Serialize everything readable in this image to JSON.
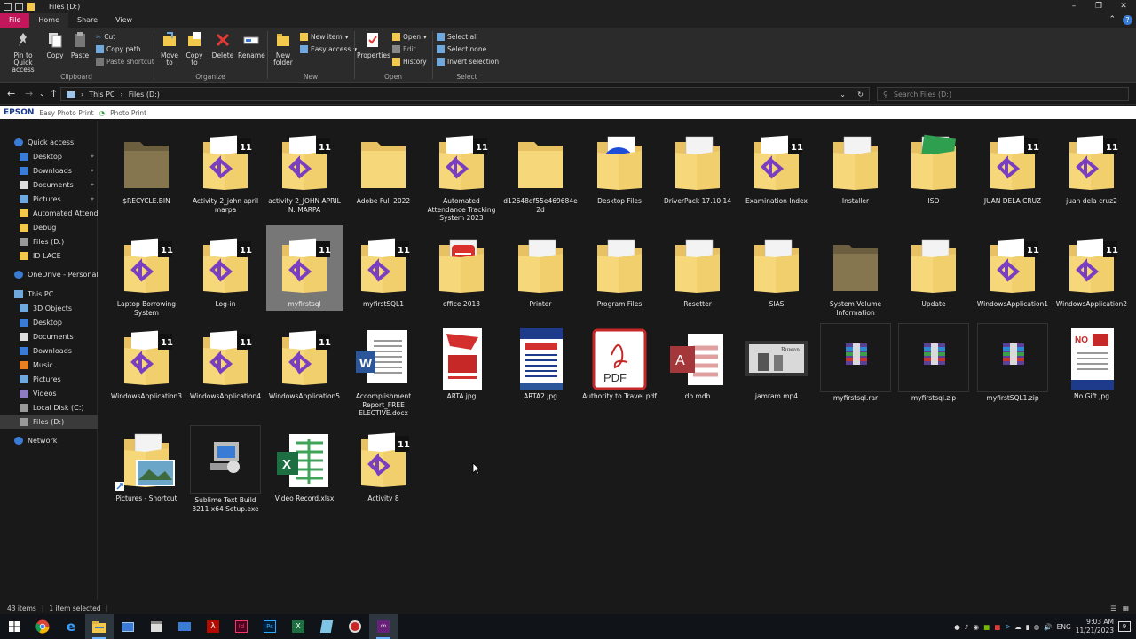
{
  "window": {
    "title": "Files (D:)"
  },
  "tabs": [
    "File",
    "Home",
    "Share",
    "View"
  ],
  "ribbon": {
    "clipboard": {
      "label": "Clipboard",
      "pin": "Pin to Quick access",
      "copy": "Copy",
      "paste": "Paste",
      "cut": "Cut",
      "copy_path": "Copy path",
      "paste_shortcut": "Paste shortcut"
    },
    "organize": {
      "label": "Organize",
      "move_to": "Move to",
      "copy_to": "Copy to",
      "delete": "Delete",
      "rename": "Rename"
    },
    "new": {
      "label": "New",
      "new_folder": "New folder",
      "new_item": "New item",
      "easy_access": "Easy access"
    },
    "open": {
      "label": "Open",
      "properties": "Properties",
      "open": "Open",
      "edit": "Edit",
      "history": "History"
    },
    "select": {
      "label": "Select",
      "select_all": "Select all",
      "select_none": "Select none",
      "invert": "Invert selection"
    }
  },
  "address": {
    "crumbs": [
      "This PC",
      "Files (D:)"
    ],
    "search_placeholder": "Search Files (D:)"
  },
  "epson": {
    "brand": "EPSON",
    "easy": "Easy Photo Print",
    "photo": "Photo Print"
  },
  "sidebar": [
    {
      "label": "Quick access",
      "icon": "star-icon",
      "kind": "head"
    },
    {
      "label": "Desktop",
      "icon": "desktop-icon",
      "pin": true
    },
    {
      "label": "Downloads",
      "icon": "download-icon",
      "pin": true
    },
    {
      "label": "Documents",
      "icon": "document-icon",
      "pin": true
    },
    {
      "label": "Pictures",
      "icon": "picture-icon",
      "pin": true
    },
    {
      "label": "Automated Attendan",
      "icon": "folder-icon"
    },
    {
      "label": "Debug",
      "icon": "folder-icon"
    },
    {
      "label": "Files (D:)",
      "icon": "drive-icon"
    },
    {
      "label": "ID LACE",
      "icon": "folder-icon"
    },
    {
      "label": "OneDrive - Personal",
      "icon": "cloud-icon",
      "kind": "head"
    },
    {
      "label": "This PC",
      "icon": "pc-icon",
      "kind": "head"
    },
    {
      "label": "3D Objects",
      "icon": "cube-icon"
    },
    {
      "label": "Desktop",
      "icon": "desktop-icon"
    },
    {
      "label": "Documents",
      "icon": "document-icon"
    },
    {
      "label": "Downloads",
      "icon": "download-icon"
    },
    {
      "label": "Music",
      "icon": "music-icon"
    },
    {
      "label": "Pictures",
      "icon": "picture-icon"
    },
    {
      "label": "Videos",
      "icon": "video-icon"
    },
    {
      "label": "Local Disk (C:)",
      "icon": "drive-icon"
    },
    {
      "label": "Files (D:)",
      "icon": "drive-icon",
      "selected": true
    },
    {
      "label": "Network",
      "icon": "network-icon",
      "kind": "head"
    }
  ],
  "items": [
    {
      "label": "$RECYCLE.BIN",
      "type": "folder-dark"
    },
    {
      "label": "Activity 2_john april marpa",
      "type": "folder-vs"
    },
    {
      "label": "activity 2_JOHN APRIL N. MARPA",
      "type": "folder-vs"
    },
    {
      "label": "Adobe Full 2022",
      "type": "folder"
    },
    {
      "label": "Automated Attendance Tracking System 2023",
      "type": "folder-vs"
    },
    {
      "label": "d12648df55e469684e2d",
      "type": "folder"
    },
    {
      "label": "Desktop Files",
      "type": "folder-blue"
    },
    {
      "label": "DriverPack 17.10.14",
      "type": "folder-doc"
    },
    {
      "label": "Examination Index",
      "type": "folder-vs"
    },
    {
      "label": "Installer",
      "type": "folder-doc"
    },
    {
      "label": "ISO",
      "type": "folder-green"
    },
    {
      "label": "JUAN DELA CRUZ",
      "type": "folder-vs"
    },
    {
      "label": "juan dela cruz2",
      "type": "folder-vs"
    },
    {
      "label": "Laptop Borrowing System",
      "type": "folder-vs"
    },
    {
      "label": "Log-in",
      "type": "folder-vs"
    },
    {
      "label": "myfirstsql",
      "type": "folder-vs",
      "selected": true
    },
    {
      "label": "myfirstSQL1",
      "type": "folder-vs"
    },
    {
      "label": "office 2013",
      "type": "folder-red"
    },
    {
      "label": "Printer",
      "type": "folder-doc"
    },
    {
      "label": "Program Files",
      "type": "folder-doc"
    },
    {
      "label": "Resetter",
      "type": "folder-doc"
    },
    {
      "label": "SIAS",
      "type": "folder-doc"
    },
    {
      "label": "System Volume Information",
      "type": "folder-dark"
    },
    {
      "label": "Update",
      "type": "folder-doc"
    },
    {
      "label": "WindowsApplication1",
      "type": "folder-vs"
    },
    {
      "label": "WindowsApplication2",
      "type": "folder-vs"
    },
    {
      "label": "WindowsApplication3",
      "type": "folder-vs"
    },
    {
      "label": "WindowsApplication4",
      "type": "folder-vs"
    },
    {
      "label": "WindowsApplication5",
      "type": "folder-vs"
    },
    {
      "label": "Accomplishment Report_FREE ELECTIVE.docx",
      "type": "word"
    },
    {
      "label": "ARTA.jpg",
      "type": "poster-red"
    },
    {
      "label": "ARTA2.jpg",
      "type": "poster-blue"
    },
    {
      "label": "Authority to Travel.pdf",
      "type": "pdf"
    },
    {
      "label": "db.mdb",
      "type": "access"
    },
    {
      "label": "jamram.mp4",
      "type": "video"
    },
    {
      "label": "myfirstsql.rar",
      "type": "rar"
    },
    {
      "label": "myfirstsql.zip",
      "type": "rar"
    },
    {
      "label": "myfirstSQL1.zip",
      "type": "rar"
    },
    {
      "label": "No Gift.jpg",
      "type": "poster-nogift"
    },
    {
      "label": "Pictures - Shortcut",
      "type": "folder-pic"
    },
    {
      "label": "Sublime Text Build 3211 x64 Setup.exe",
      "type": "setup"
    },
    {
      "label": "Video Record.xlsx",
      "type": "excel"
    },
    {
      "label": "Activity 8",
      "type": "folder-vs"
    }
  ],
  "status": {
    "count": "43 items",
    "selected": "1 item selected"
  },
  "taskbar": {
    "lang": "ENG",
    "time": "9:03 AM",
    "date": "11/21/2023",
    "notif": "9"
  }
}
